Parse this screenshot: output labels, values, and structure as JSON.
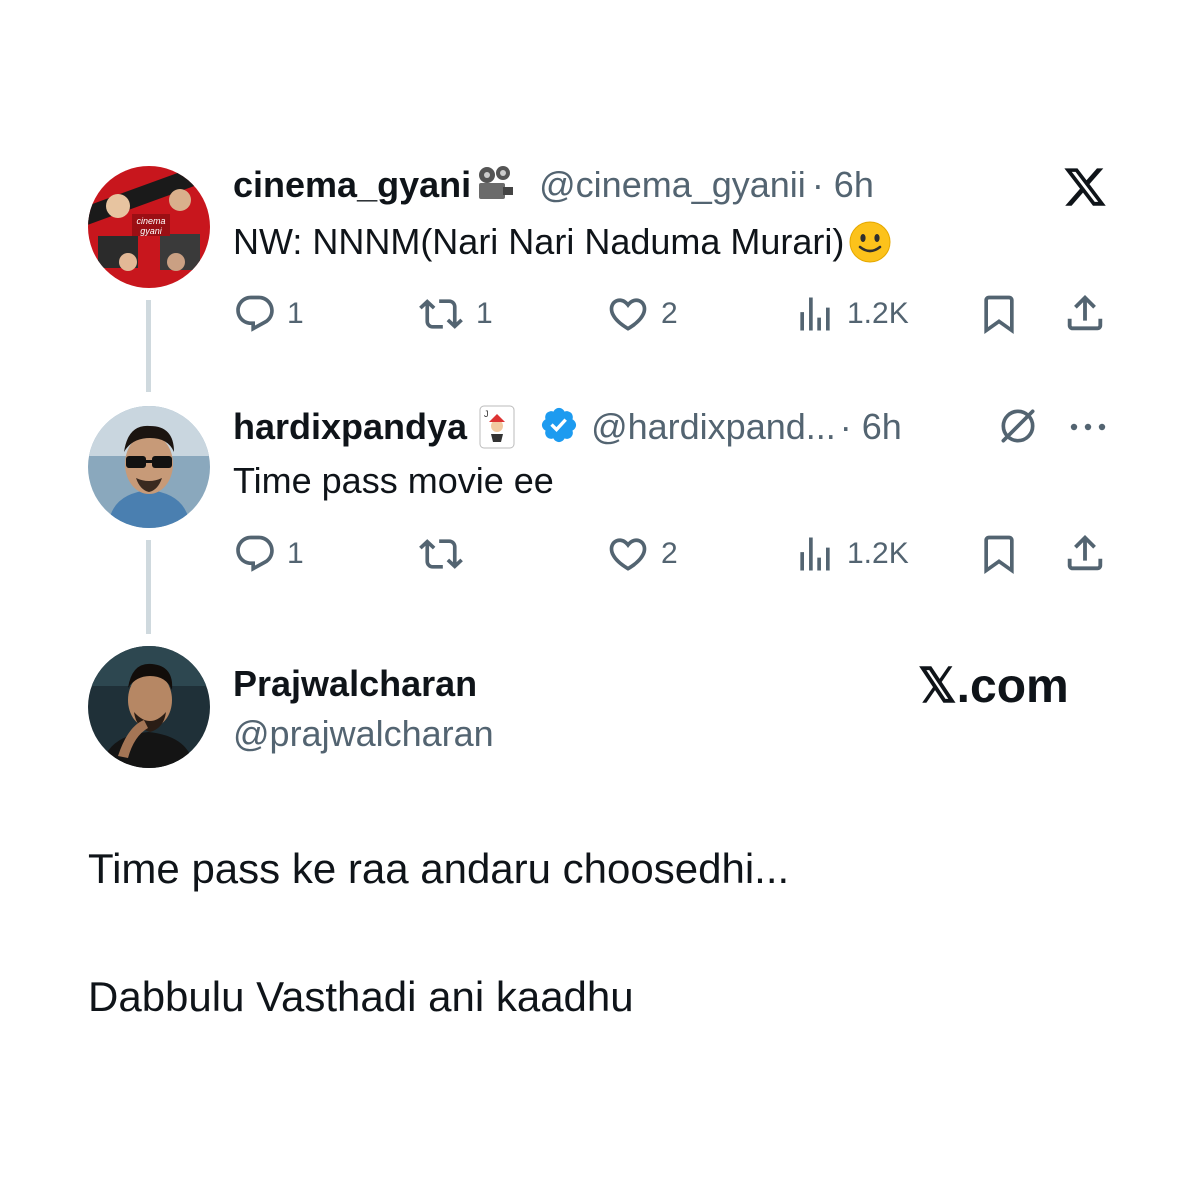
{
  "tweet1": {
    "display_name": "cinema_gyani",
    "handle": "@cinema_gyanii",
    "time": "· 6h",
    "text": "NW: NNNM(Nari Nari Naduma Murari)",
    "avatar_text": "cinema gyani",
    "stats": {
      "replies": "1",
      "reposts": "1",
      "likes": "2",
      "views": "1.2K"
    }
  },
  "tweet2": {
    "display_name": "hardixpandya",
    "handle": "@hardixpand...",
    "time": "· 6h",
    "text": "Time pass movie ee",
    "stats": {
      "replies": "1",
      "reposts": "",
      "likes": "2",
      "views": "1.2K"
    }
  },
  "tweet3": {
    "display_name": "Prajwalcharan",
    "handle": "@prajwalcharan",
    "brand": "𝕏.com",
    "line1": "Time pass ke raa andaru choosedhi...",
    "line2": "Dabbulu Vasthadi ani kaadhu"
  },
  "icons": {
    "app_logo": "x-logo-icon",
    "reply": "reply-icon",
    "repost": "repost-icon",
    "like": "heart-icon",
    "views": "views-icon",
    "bookmark": "bookmark-icon",
    "share": "share-icon",
    "verified": "verified-badge-icon",
    "more": "more-icon",
    "grok": "grok-icon"
  },
  "colors": {
    "text": "#0f1419",
    "muted": "#536471",
    "verified": "#1d9bf0",
    "line": "#cfd9de"
  }
}
